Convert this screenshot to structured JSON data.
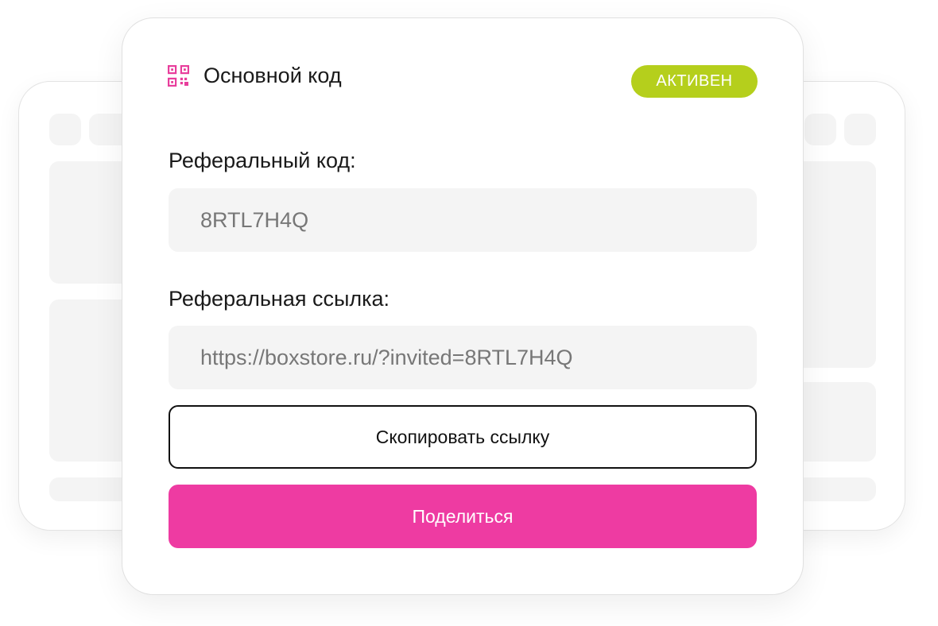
{
  "card": {
    "title": "Основной код",
    "title_icon": "qr-code-icon",
    "status": "АКТИВЕН"
  },
  "referral_code": {
    "label": "Реферальный код:",
    "value": "8RTL7H4Q"
  },
  "referral_link": {
    "label": "Реферальная ссылка:",
    "value": "https://boxstore.ru/?invited=8RTL7H4Q"
  },
  "buttons": {
    "copy_label": "Скопировать ссылку",
    "share_label": "Поделиться"
  },
  "colors": {
    "accent_pink": "#ee3ba2",
    "status_green": "#b5cf1c",
    "field_bg": "#f4f4f4"
  }
}
